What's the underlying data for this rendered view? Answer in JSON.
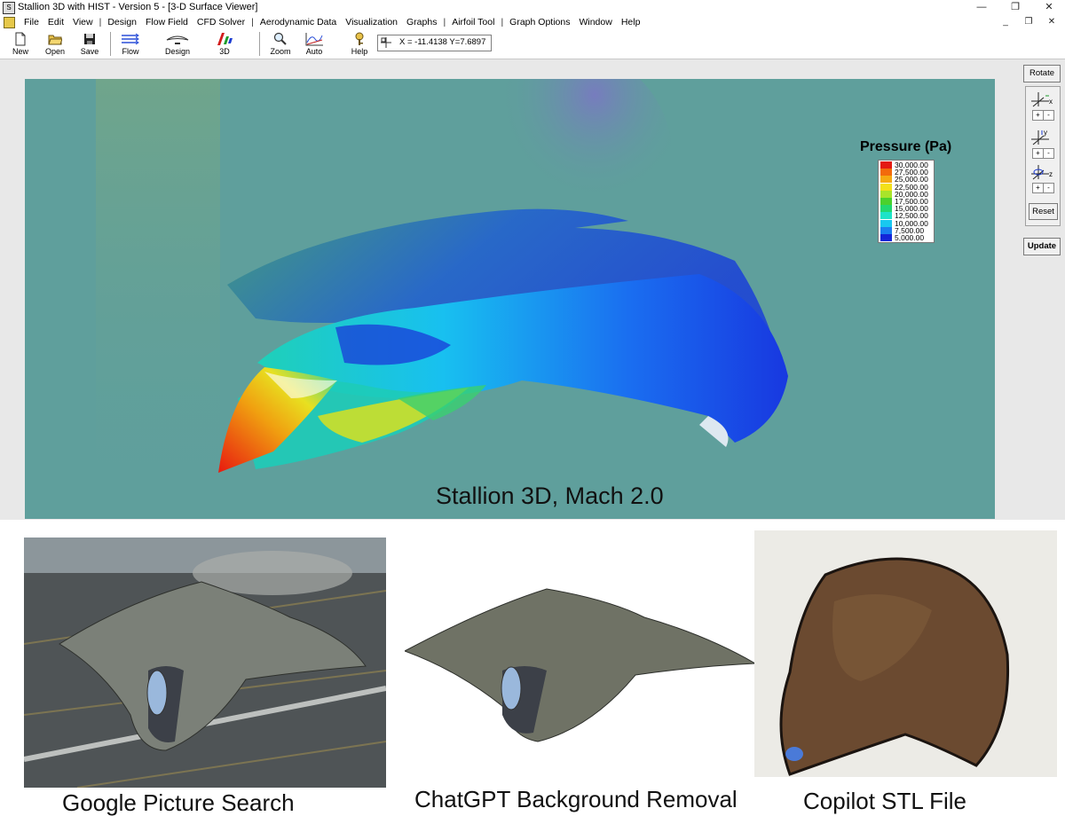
{
  "window": {
    "app_icon": "stallion-app-icon",
    "title": "Stallion 3D with HIST - Version 5 - [3-D Surface Viewer]",
    "controls": {
      "minimize": "—",
      "restore": "❐",
      "close": "✕"
    },
    "mdi_controls": {
      "minimize": "_",
      "restore": "❐",
      "close": "✕"
    }
  },
  "menu": {
    "items": [
      "File",
      "Edit",
      "View",
      "|",
      "Design",
      "Flow Field",
      "CFD Solver",
      "|",
      "Aerodynamic Data",
      "Visualization",
      "Graphs",
      "|",
      "Airfoil Tool",
      "|",
      "Graph Options",
      "Window",
      "Help"
    ]
  },
  "toolbar": {
    "new": "New",
    "open": "Open",
    "save": "Save",
    "flow": "Flow",
    "design": "Design",
    "three_d": "3D",
    "zoom": "Zoom",
    "auto": "Auto",
    "help": "Help",
    "coords": "X = -11.4138  Y=7.6897"
  },
  "side_panel": {
    "rotate": "Rotate",
    "x_label": "x",
    "y_label": "y",
    "z_label": "z",
    "plus": "+",
    "minus": "-",
    "reset": "Reset",
    "update": "Update"
  },
  "legend": {
    "title": "Pressure (Pa)",
    "entries": [
      {
        "value": "30,000.00",
        "color": "#e41a12"
      },
      {
        "value": "27,500.00",
        "color": "#f26a0c"
      },
      {
        "value": "25,000.00",
        "color": "#f5a912"
      },
      {
        "value": "22,500.00",
        "color": "#f3e01a"
      },
      {
        "value": "20,000.00",
        "color": "#a9e42a"
      },
      {
        "value": "17,500.00",
        "color": "#4bd12d"
      },
      {
        "value": "15,000.00",
        "color": "#22d870"
      },
      {
        "value": "12,500.00",
        "color": "#1de3c8"
      },
      {
        "value": "10,000.00",
        "color": "#18c8f0"
      },
      {
        "value": "7,500.00",
        "color": "#1a7ef0"
      },
      {
        "value": "5,000.00",
        "color": "#1425d8"
      }
    ]
  },
  "viewport_caption": "Stallion 3D, Mach 2.0",
  "photos": [
    {
      "caption": "Google Picture Search"
    },
    {
      "caption": "ChatGPT Background Removal"
    },
    {
      "caption": "Copilot STL File"
    }
  ]
}
